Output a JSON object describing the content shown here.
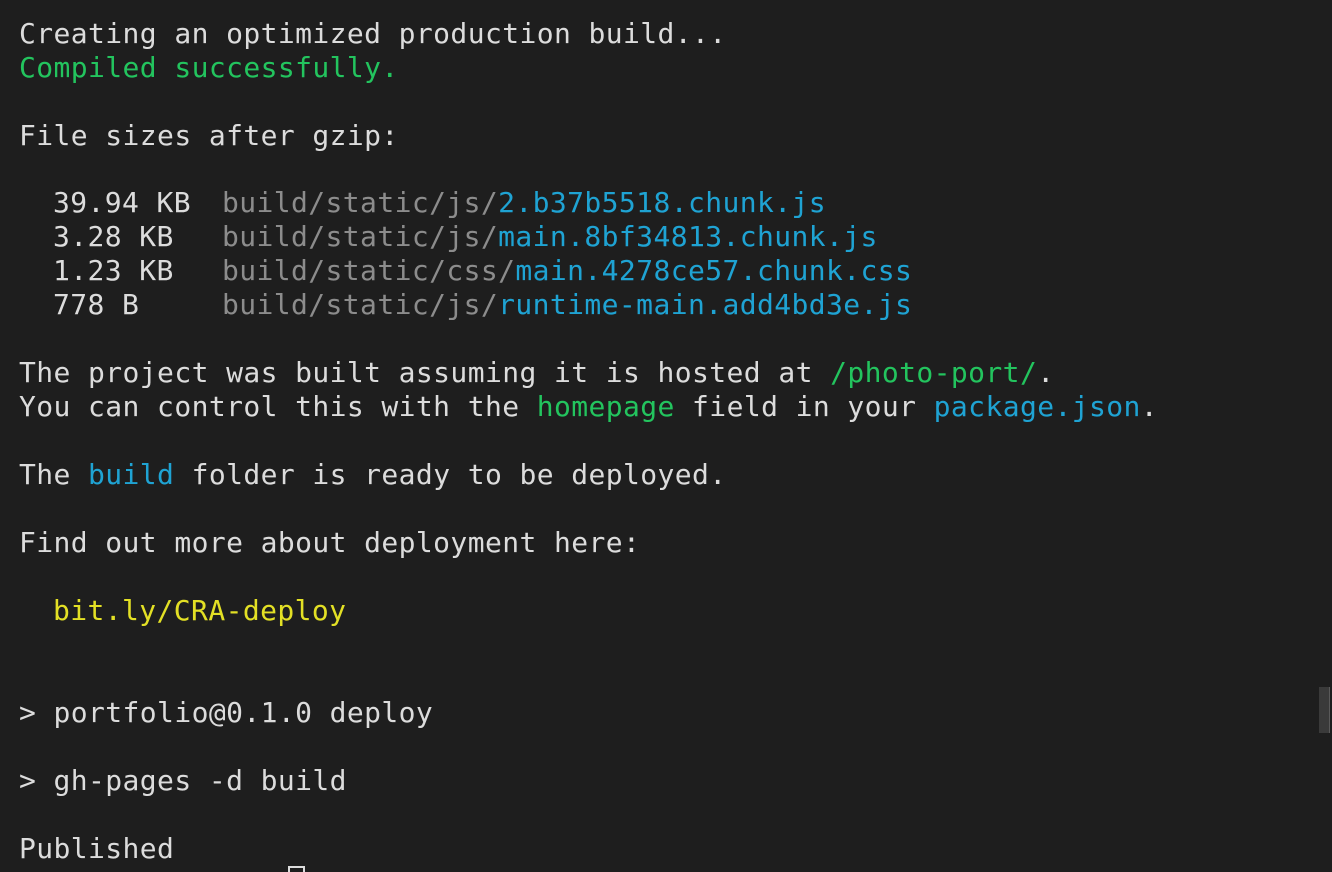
{
  "terminal": {
    "build_header": "Creating an optimized production build...",
    "compiled": "Compiled successfully.",
    "sizes_header": "File sizes after gzip:",
    "files": [
      {
        "size": "39.94 KB",
        "dir": "build/static/js/",
        "name": "2.b37b5518.chunk.js"
      },
      {
        "size": "3.28 KB",
        "dir": "build/static/js/",
        "name": "main.8bf34813.chunk.js"
      },
      {
        "size": "1.23 KB",
        "dir": "build/static/css/",
        "name": "main.4278ce57.chunk.css"
      },
      {
        "size": "778 B",
        "dir": "build/static/js/",
        "name": "runtime-main.add4bd3e.js"
      }
    ],
    "hosted": {
      "prefix": "The project was built assuming it is hosted at ",
      "path": "/photo-port/",
      "suffix": "."
    },
    "control": {
      "prefix": "You can control this with the ",
      "field": "homepage",
      "middle": " field in your ",
      "file": "package.json",
      "suffix": "."
    },
    "ready": {
      "prefix": "The ",
      "folder": "build",
      "suffix": " folder is ready to be deployed."
    },
    "deploy_more": "Find out more about deployment here:",
    "deploy_link": "bit.ly/CRA-deploy",
    "cmd1": "> portfolio@0.1.0 deploy",
    "cmd2": "> gh-pages -d build",
    "published": "Published"
  },
  "colors": {
    "background": "#1e1e1e",
    "text": "#dcdcdc",
    "success": "#23c45e",
    "path_dim": "#8c8c8c",
    "filename": "#1fa3d3",
    "link": "#e3e025"
  }
}
